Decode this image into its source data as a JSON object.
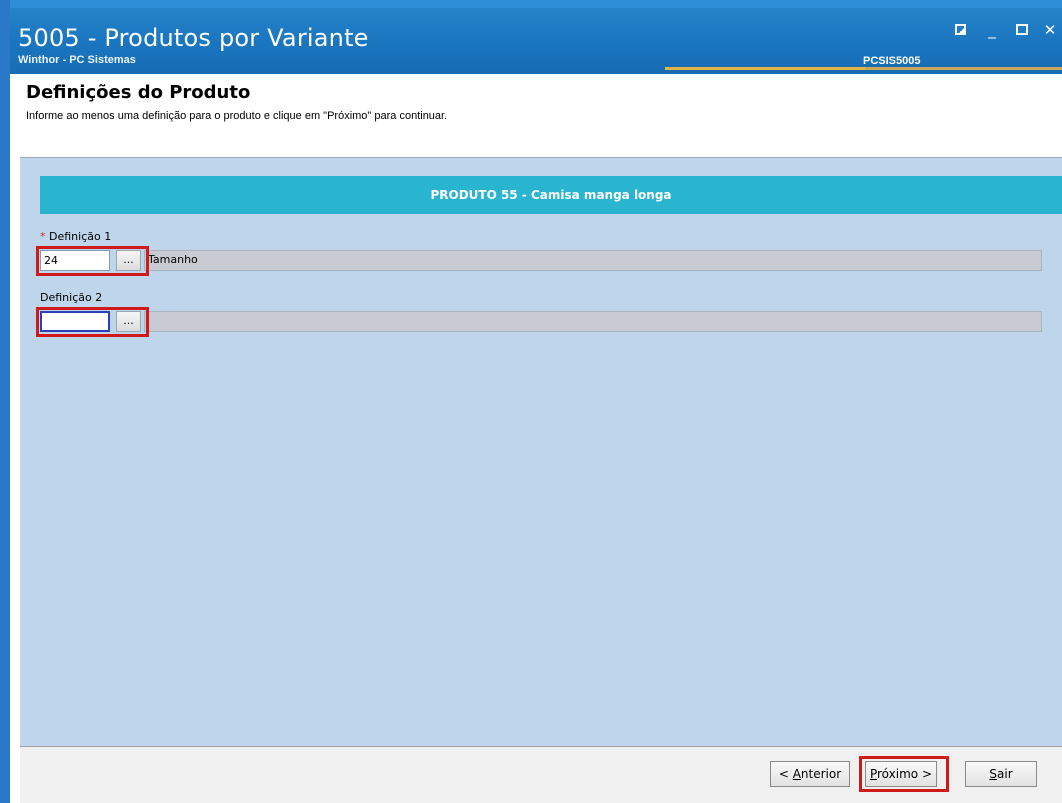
{
  "window": {
    "title": "5005 - Produtos por Variante",
    "subtitle": "Winthor - PC Sistemas",
    "code": "PCSIS5005",
    "controls": [
      "restore-icon",
      "minimize-icon",
      "maximize-icon",
      "close-icon"
    ]
  },
  "header": {
    "title": "Definições do Produto",
    "instruction": "Informe ao menos uma definição para o produto e clique em \"Próximo\" para continuar."
  },
  "product": {
    "banner": "PRODUTO 55 - Camisa manga longa"
  },
  "definitions": [
    {
      "label": "Definição 1",
      "required_mark": "*",
      "code": "24",
      "lookup_label": "...",
      "description": "Tamanho"
    },
    {
      "label": "Definição 2",
      "code": "",
      "lookup_label": "...",
      "description": ""
    }
  ],
  "footer": {
    "prev_accesskey": "A",
    "prev_rest": "nterior",
    "prev_prefix": "< ",
    "next_accesskey": "P",
    "next_rest": "róximo",
    "next_suffix": " >",
    "exit_accesskey": "S",
    "exit_rest": "air"
  },
  "colors": {
    "titlebar": "#1a75bf",
    "banner": "#29b4d0",
    "content_bg": "#bfd5eb",
    "highlight": "#d01a1a"
  }
}
